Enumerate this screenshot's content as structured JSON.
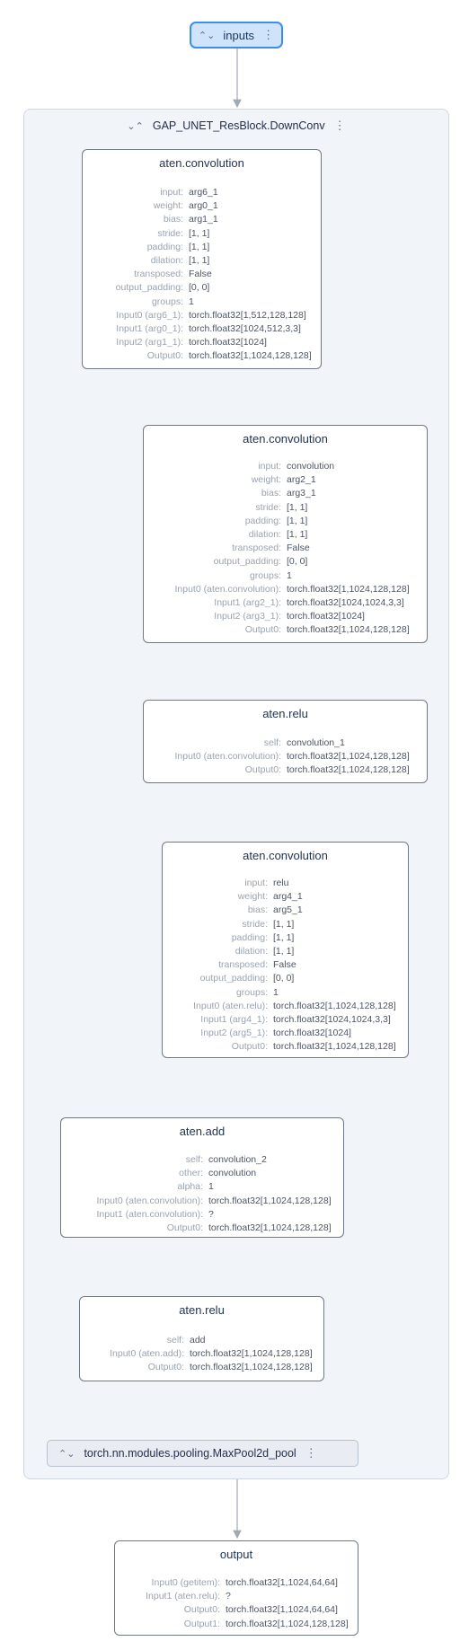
{
  "input_pill": {
    "label": "inputs"
  },
  "group": {
    "title": "GAP_UNET_ResBlock.DownConv"
  },
  "collapsed_module": {
    "label": "torch.nn.modules.pooling.MaxPool2d_pool"
  },
  "nodes": {
    "conv1": {
      "title": "aten.convolution",
      "attrs": [
        {
          "k": "input:",
          "v": "arg6_1"
        },
        {
          "k": "weight:",
          "v": "arg0_1"
        },
        {
          "k": "bias:",
          "v": "arg1_1"
        },
        {
          "k": "stride:",
          "v": "[1, 1]"
        },
        {
          "k": "padding:",
          "v": "[1, 1]"
        },
        {
          "k": "dilation:",
          "v": "[1, 1]"
        },
        {
          "k": "transposed:",
          "v": "False"
        },
        {
          "k": "output_padding:",
          "v": "[0, 0]"
        },
        {
          "k": "groups:",
          "v": "1"
        },
        {
          "k": "Input0 (arg6_1):",
          "v": "torch.float32[1,512,128,128]"
        },
        {
          "k": "Input1 (arg0_1):",
          "v": "torch.float32[1024,512,3,3]"
        },
        {
          "k": "Input2 (arg1_1):",
          "v": "torch.float32[1024]"
        },
        {
          "k": "Output0:",
          "v": "torch.float32[1,1024,128,128]"
        }
      ]
    },
    "conv2": {
      "title": "aten.convolution",
      "attrs": [
        {
          "k": "input:",
          "v": "convolution"
        },
        {
          "k": "weight:",
          "v": "arg2_1"
        },
        {
          "k": "bias:",
          "v": "arg3_1"
        },
        {
          "k": "stride:",
          "v": "[1, 1]"
        },
        {
          "k": "padding:",
          "v": "[1, 1]"
        },
        {
          "k": "dilation:",
          "v": "[1, 1]"
        },
        {
          "k": "transposed:",
          "v": "False"
        },
        {
          "k": "output_padding:",
          "v": "[0, 0]"
        },
        {
          "k": "groups:",
          "v": "1"
        },
        {
          "k": "Input0 (aten.convolution):",
          "v": "torch.float32[1,1024,128,128]"
        },
        {
          "k": "Input1 (arg2_1):",
          "v": "torch.float32[1024,1024,3,3]"
        },
        {
          "k": "Input2 (arg3_1):",
          "v": "torch.float32[1024]"
        },
        {
          "k": "Output0:",
          "v": "torch.float32[1,1024,128,128]"
        }
      ]
    },
    "relu1": {
      "title": "aten.relu",
      "attrs": [
        {
          "k": "self:",
          "v": "convolution_1"
        },
        {
          "k": "Input0 (aten.convolution):",
          "v": "torch.float32[1,1024,128,128]"
        },
        {
          "k": "Output0:",
          "v": "torch.float32[1,1024,128,128]"
        }
      ]
    },
    "conv3": {
      "title": "aten.convolution",
      "attrs": [
        {
          "k": "input:",
          "v": "relu"
        },
        {
          "k": "weight:",
          "v": "arg4_1"
        },
        {
          "k": "bias:",
          "v": "arg5_1"
        },
        {
          "k": "stride:",
          "v": "[1, 1]"
        },
        {
          "k": "padding:",
          "v": "[1, 1]"
        },
        {
          "k": "dilation:",
          "v": "[1, 1]"
        },
        {
          "k": "transposed:",
          "v": "False"
        },
        {
          "k": "output_padding:",
          "v": "[0, 0]"
        },
        {
          "k": "groups:",
          "v": "1"
        },
        {
          "k": "Input0 (aten.relu):",
          "v": "torch.float32[1,1024,128,128]"
        },
        {
          "k": "Input1 (arg4_1):",
          "v": "torch.float32[1024,1024,3,3]"
        },
        {
          "k": "Input2 (arg5_1):",
          "v": "torch.float32[1024]"
        },
        {
          "k": "Output0:",
          "v": "torch.float32[1,1024,128,128]"
        }
      ]
    },
    "add": {
      "title": "aten.add",
      "attrs": [
        {
          "k": "self:",
          "v": "convolution_2"
        },
        {
          "k": "other:",
          "v": "convolution"
        },
        {
          "k": "alpha:",
          "v": "1"
        },
        {
          "k": "Input0 (aten.convolution):",
          "v": "torch.float32[1,1024,128,128]"
        },
        {
          "k": "Input1 (aten.convolution):",
          "v": "?"
        },
        {
          "k": "Output0:",
          "v": "torch.float32[1,1024,128,128]"
        }
      ]
    },
    "relu2": {
      "title": "aten.relu",
      "attrs": [
        {
          "k": "self:",
          "v": "add"
        },
        {
          "k": "Input0 (aten.add):",
          "v": "torch.float32[1,1024,128,128]"
        },
        {
          "k": "Output0:",
          "v": "torch.float32[1,1024,128,128]"
        }
      ]
    },
    "output": {
      "title": "output",
      "attrs": [
        {
          "k": "Input0 (getitem):",
          "v": "torch.float32[1,1024,64,64]"
        },
        {
          "k": "Input1 (aten.relu):",
          "v": "?"
        },
        {
          "k": "Output0:",
          "v": "torch.float32[1,1024,64,64]"
        },
        {
          "k": "Output1:",
          "v": "torch.float32[1,1024,128,128]"
        }
      ]
    }
  },
  "colors": {
    "edge": "#a3a9b3",
    "node_border": "#6e7886",
    "pill_fill": "#cfe3fb",
    "pill_border": "#3d8ee8",
    "group_fill": "#f1f4f9"
  },
  "icons": {
    "expand": "chevron-up-down-icon",
    "collapse": "chevron-collapse-icon",
    "menu": "kebab-menu-icon"
  }
}
